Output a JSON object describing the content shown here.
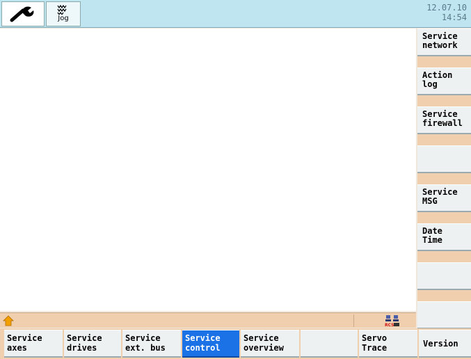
{
  "header": {
    "mode_label": "Jog",
    "date": "12.07.10",
    "time": "14:54"
  },
  "vertical_softkeys": [
    {
      "label": "Service\nnetwork"
    },
    {
      "label": "Action\nlog"
    },
    {
      "label": "Service\nfirewall"
    },
    {
      "label": ""
    },
    {
      "label": "Service\nMSG"
    },
    {
      "label": "Date\nTime"
    },
    {
      "label": ""
    },
    {
      "label": ""
    }
  ],
  "horizontal_softkeys": [
    {
      "label": "Service\naxes"
    },
    {
      "label": "Service\ndrives"
    },
    {
      "label": "Service\next. bus"
    },
    {
      "label": "Service\ncontrol",
      "active": true
    },
    {
      "label": "Service\noverview"
    },
    {
      "label": ""
    },
    {
      "label": "Servo\nTrace"
    },
    {
      "label": "Version"
    }
  ],
  "status_bar": {
    "icons": [
      "home-icon",
      "rcs-network-icon"
    ]
  },
  "colors": {
    "active_softkey": "#1a72e6",
    "header_bg": "#bfe6f0",
    "status_bg": "#f0cfae"
  }
}
